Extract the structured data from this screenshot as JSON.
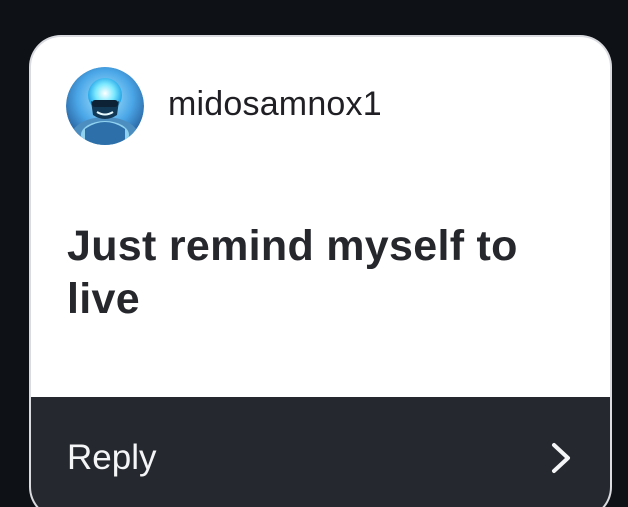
{
  "user": {
    "username": "midosamnox1",
    "avatar_icon": "profile-avatar"
  },
  "post": {
    "text": "Just remind myself to live"
  },
  "reply": {
    "label": "Reply",
    "icon": "chevron-right-icon"
  },
  "colors": {
    "background": "#0e1116",
    "card": "#ffffff",
    "reply_bar": "#25282e",
    "text_dark": "#26272d",
    "text_light": "#f4f5f7"
  }
}
